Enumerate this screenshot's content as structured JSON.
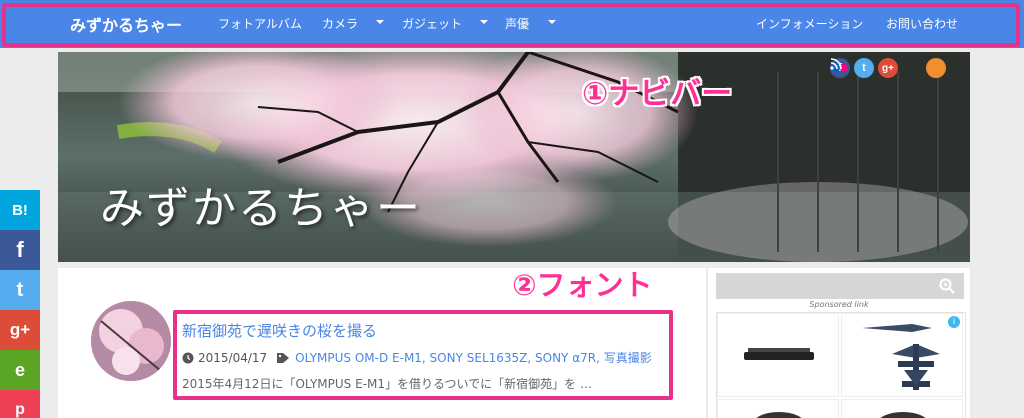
{
  "nav": {
    "brand": "みずかるちゃー",
    "items": [
      {
        "label": "フォトアルバム",
        "dropdown": false
      },
      {
        "label": "カメラ",
        "dropdown": true
      },
      {
        "label": "ガジェット",
        "dropdown": true
      },
      {
        "label": "声優",
        "dropdown": true
      }
    ],
    "right_items": [
      {
        "label": "インフォメーション"
      },
      {
        "label": "お問い合わせ"
      }
    ]
  },
  "header": {
    "site_title": "みずかるちゃー",
    "social_icons": [
      "facebook-icon",
      "twitter-icon",
      "google-plus-icon",
      "flickr-icon",
      "rss-icon"
    ],
    "social_glyphs": {
      "facebook": "f",
      "twitter": "t",
      "google_plus": "g+",
      "rss": "⁂"
    }
  },
  "annotations": {
    "navbar": "①ナビバー",
    "font": "②フォント"
  },
  "post": {
    "title": "新宿御苑で遅咲きの桜を撮る",
    "date": "2015/04/17",
    "categories": "OLYMPUS OM-D E-M1, SONY SEL1635Z, SONY α7R, 写真撮影",
    "excerpt": "2015年4月12日に「OLYMPUS E-M1」を借りるついでに「新宿御苑」を …"
  },
  "sidebar": {
    "sponsored_label": "Sponsored link",
    "ad_info": "i"
  },
  "share": {
    "buttons": [
      {
        "name": "hatena-bookmark",
        "glyph": "B!",
        "color": "#00a4de"
      },
      {
        "name": "facebook",
        "glyph": "f",
        "color": "#3b5998"
      },
      {
        "name": "twitter",
        "glyph": "t",
        "color": "#55acee"
      },
      {
        "name": "google-plus",
        "glyph": "g+",
        "color": "#dd4b39"
      },
      {
        "name": "evernote",
        "glyph": "e",
        "color": "#5ba525"
      },
      {
        "name": "pocket",
        "glyph": "p",
        "color": "#ef4056"
      }
    ]
  },
  "colors": {
    "nav_bg": "#4a86e8",
    "annotation": "#e8318a",
    "link": "#4a86e8"
  }
}
